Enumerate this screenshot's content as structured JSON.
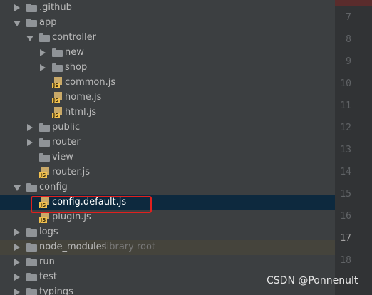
{
  "tree": {
    "items": [
      {
        "label": ".github",
        "type": "folder",
        "state": "collapsed"
      },
      {
        "label": "app",
        "type": "folder",
        "state": "expanded"
      },
      {
        "label": "controller",
        "type": "folder",
        "state": "expanded"
      },
      {
        "label": "new",
        "type": "folder",
        "state": "collapsed"
      },
      {
        "label": "shop",
        "type": "folder",
        "state": "collapsed"
      },
      {
        "label": "common.js",
        "type": "js-file"
      },
      {
        "label": "home.js",
        "type": "js-file"
      },
      {
        "label": "html.js",
        "type": "js-file"
      },
      {
        "label": "public",
        "type": "folder",
        "state": "collapsed"
      },
      {
        "label": "router",
        "type": "folder",
        "state": "collapsed"
      },
      {
        "label": "view",
        "type": "folder"
      },
      {
        "label": "router.js",
        "type": "js-file"
      },
      {
        "label": "config",
        "type": "folder",
        "state": "expanded"
      },
      {
        "label": "config.default.js",
        "type": "js-file",
        "selected": true
      },
      {
        "label": "plugin.js",
        "type": "js-file"
      },
      {
        "label": "logs",
        "type": "folder",
        "state": "collapsed"
      },
      {
        "label": "node_modules",
        "suffix": "library root",
        "type": "folder",
        "state": "collapsed"
      },
      {
        "label": "run",
        "type": "folder",
        "state": "collapsed"
      },
      {
        "label": "test",
        "type": "folder",
        "state": "collapsed"
      },
      {
        "label": "typings",
        "type": "folder",
        "state": "collapsed"
      }
    ],
    "js_badge": "JS"
  },
  "gutter": {
    "line_numbers": [
      "7",
      "8",
      "9",
      "10",
      "11",
      "12",
      "13",
      "14",
      "15",
      "16",
      "17",
      "18"
    ],
    "current_line": "17"
  },
  "watermark": "CSDN @Ponnenult",
  "colors": {
    "background": "#3c3f41",
    "selection": "#0d293e",
    "library_row": "#45443c",
    "highlight_box": "#e0201e",
    "folder_icon": "#8f9397",
    "js_icon": "#f2c14e"
  }
}
